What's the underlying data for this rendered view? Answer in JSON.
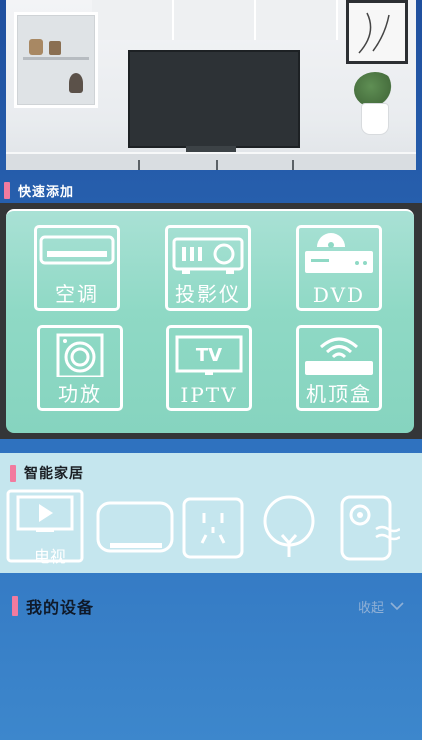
{
  "quick_add": {
    "title": "快速添加",
    "items": [
      {
        "label": "空调",
        "icon": "air-conditioner-icon"
      },
      {
        "label": "投影仪",
        "icon": "projector-icon"
      },
      {
        "label": "DVD",
        "icon": "dvd-player-icon"
      },
      {
        "label": "功放",
        "icon": "amplifier-speaker-icon"
      },
      {
        "label": "IPTV",
        "icon": "iptv-icon",
        "icon_text": "TV"
      },
      {
        "label": "机顶盒",
        "icon": "set-top-box-icon"
      }
    ]
  },
  "smart_home": {
    "title": "智能家居",
    "items": [
      {
        "label": "电视",
        "icon": "tv-play-icon"
      },
      {
        "icon": "air-conditioner-outline-icon"
      },
      {
        "icon": "smart-socket-icon"
      },
      {
        "icon": "light-bulb-icon"
      },
      {
        "icon": "humidifier-icon"
      }
    ]
  },
  "my_devices": {
    "title": "我的设备",
    "collapse_label": "收起"
  },
  "colors": {
    "accent_bar": "#f27b9f",
    "quick_panel": "#8fd9c5",
    "smart_home_bg": "#c5e6ee",
    "background": "#2f72bf"
  }
}
